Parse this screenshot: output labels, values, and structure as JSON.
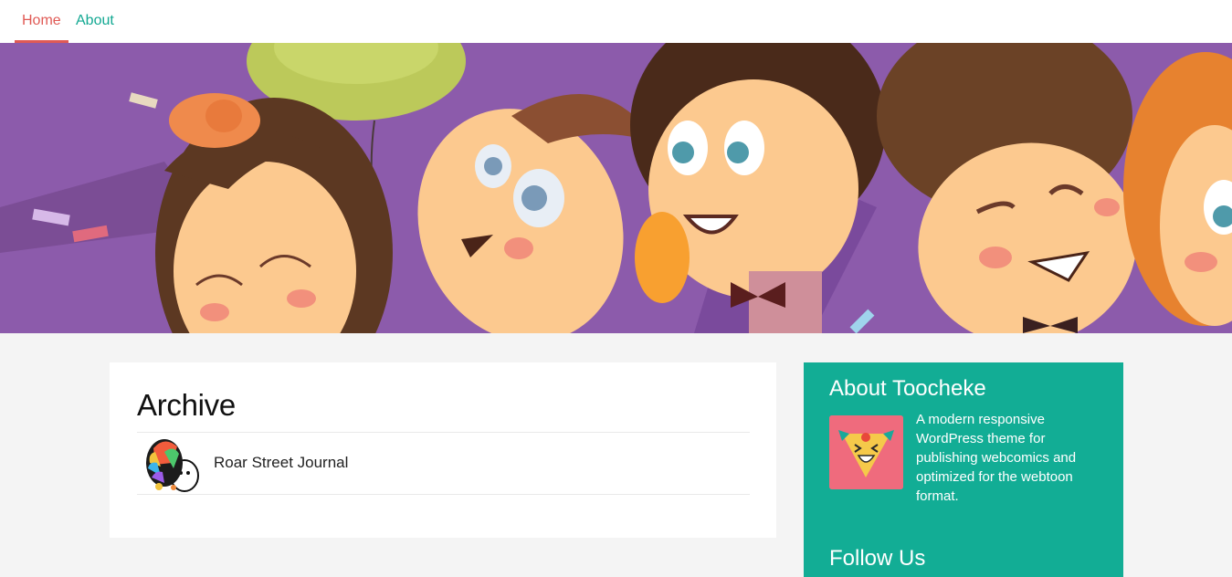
{
  "nav": {
    "items": [
      {
        "label": "Home",
        "active": true
      },
      {
        "label": "About",
        "active": false
      }
    ]
  },
  "banner": {
    "description": "cartoon kids at a party header illustration",
    "background_color": "#8c5bab"
  },
  "archive": {
    "title": "Archive",
    "items": [
      {
        "label": "Roar Street Journal",
        "thumb_icon": "colorful-character-thumbnail"
      }
    ]
  },
  "sidebar": {
    "about_title": "About Toocheke",
    "about_text": "A modern responsive WordPress theme for publishing webcomics and optimized for the webtoon format.",
    "logo_icon": "toocheke-clown-logo",
    "follow_title": "Follow Us",
    "background_color": "#12ad95"
  },
  "colors": {
    "accent_red": "#e05a55",
    "accent_teal": "#12a892"
  }
}
